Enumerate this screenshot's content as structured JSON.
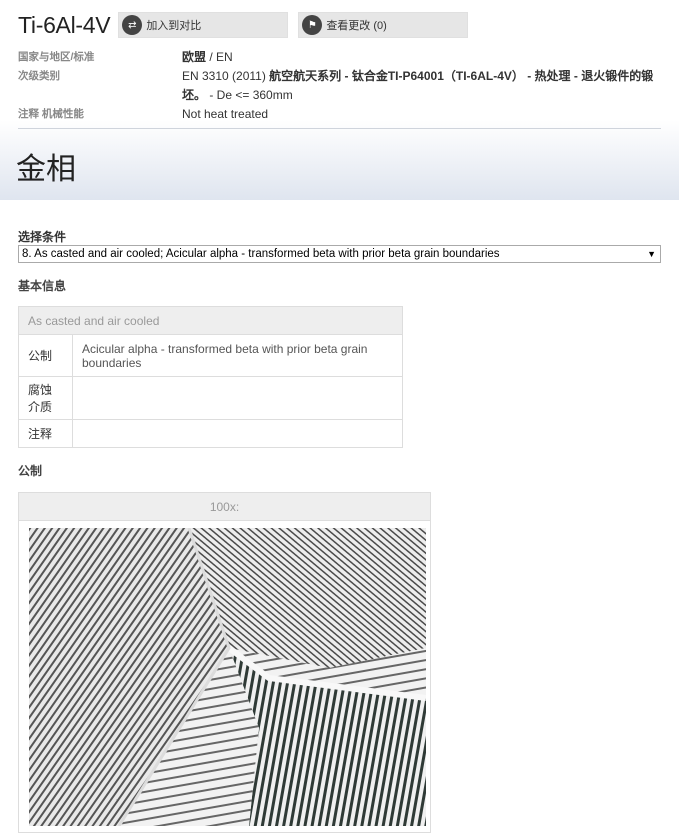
{
  "header": {
    "material_title": "Ti-6Al-4V",
    "compare_label": "加入到对比",
    "changes_label": "查看更改 (0)"
  },
  "meta": {
    "region_label": "国家与地区/标准",
    "region_value_strong": "欧盟",
    "region_value_rest": " / EN",
    "subclass_label": "次级类别",
    "subclass_prefix": "EN 3310 (2011) ",
    "subclass_strong": "航空航天系列 - 钛合金TI-P64001（TI-6AL-4V） - 热处理 - 退火锻件的锻坯。",
    "subclass_rest": " - De <= 360mm",
    "note_label": "注释 机械性能",
    "note_value": "Not heat treated"
  },
  "section_title": "金相",
  "condition": {
    "label": "选择条件",
    "selected": "8. As casted and air cooled; Acicular alpha - transformed beta with prior beta grain boundaries"
  },
  "basic_info": {
    "title": "基本信息",
    "table_header": "As casted and air cooled",
    "rows": [
      {
        "key": "公制",
        "value": "Acicular alpha - transformed beta with prior beta grain boundaries"
      },
      {
        "key": "腐蚀介质",
        "value": ""
      },
      {
        "key": "注释",
        "value": ""
      }
    ]
  },
  "micrograph": {
    "title": "公制",
    "magnification": "100x:"
  }
}
